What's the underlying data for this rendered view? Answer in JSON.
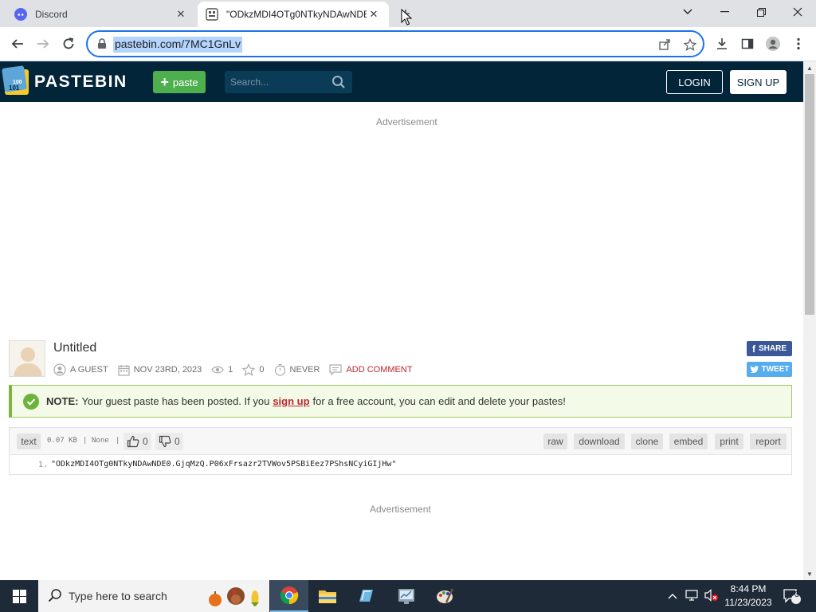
{
  "browser": {
    "tabs": [
      {
        "title": "Discord",
        "icon": "discord-icon",
        "active": false
      },
      {
        "title": "\"ODkzMDI4OTg0NTkyNDAwNDE",
        "icon": "pastebin-favicon-icon",
        "active": true
      }
    ],
    "url_text": "pastebin.com/7MC1GnLv"
  },
  "site": {
    "brand": "PASTEBIN",
    "paste_button": "paste",
    "search_placeholder": "Search...",
    "login": "LOGIN",
    "signup": "SIGN UP",
    "colors": {
      "header": "#02253a",
      "paste_button": "#4daf4e",
      "accent_red": "#c0272d"
    }
  },
  "ads": {
    "top": "Advertisement",
    "bottom": "Advertisement"
  },
  "paste": {
    "title": "Untitled",
    "author": "A GUEST",
    "date": "NOV 23RD, 2023",
    "views": "1",
    "stars": "0",
    "expiry": "NEVER",
    "comment_link": "ADD COMMENT",
    "share": "SHARE",
    "tweet": "TWEET"
  },
  "notice": {
    "label": "NOTE:",
    "text_before": "Your guest paste has been posted. If you",
    "link": "sign up",
    "text_after": "for a free account, you can edit and delete your pastes!"
  },
  "code": {
    "syntax": "text",
    "size": "0.07 KB",
    "separator": "|",
    "category": "None",
    "likes": "0",
    "dislikes": "0",
    "actions": [
      "raw",
      "download",
      "clone",
      "embed",
      "print",
      "report"
    ],
    "lines": [
      {
        "number": "1.",
        "text": "\"ODkzMDI4OTg0NTkyNDAwNDE0.GjqMzQ.P06xFrsazr2TVWov5PSBiEez7PShsNCyiGIjHw\""
      }
    ]
  },
  "taskbar": {
    "search_placeholder": "Type here to search",
    "time": "8:44 PM",
    "date": "11/23/2023",
    "notification_count": "3"
  }
}
